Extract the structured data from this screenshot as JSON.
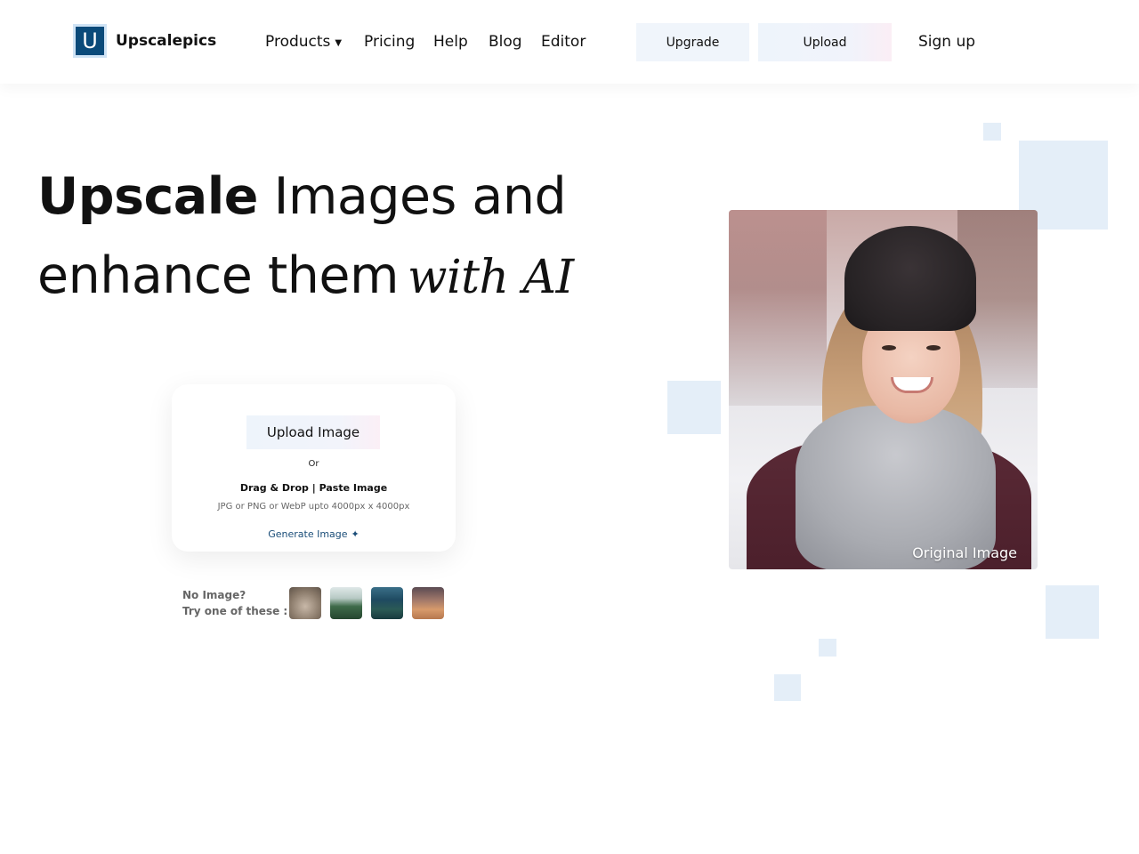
{
  "header": {
    "logo_letter": "U",
    "brand": "Upscalepics",
    "nav": [
      {
        "label": "Products",
        "has_caret": true
      },
      {
        "label": "Pricing"
      },
      {
        "label": "Help"
      },
      {
        "label": "Blog"
      },
      {
        "label": "Editor"
      }
    ],
    "caret_glyph": "▼",
    "upgrade_label": "Upgrade",
    "upload_label": "Upload",
    "signup_label": "Sign up"
  },
  "hero": {
    "line1_highlight": "Upscale",
    "line1_rest": " Images and",
    "line2_main": "enhance them",
    "line2_accent": "with AI"
  },
  "upload_card": {
    "button_label": "Upload Image",
    "or_text": "Or",
    "drag_drop_text": "Drag & Drop | Paste Image",
    "formats_text": "JPG or PNG or WebP upto 4000px x 4000px",
    "generate_label": "Generate Image",
    "sparkle_glyph": "✦"
  },
  "samples": {
    "line1": "No Image?",
    "line2": "Try one of these :",
    "thumbs": [
      "cat-thumbnail",
      "lake-thumbnail",
      "street-thumbnail",
      "laptop-thumbnail"
    ]
  },
  "hero_image": {
    "label": "Original Image"
  },
  "colors": {
    "accent": "#0a4a7a",
    "deco_square": "#e4eef8",
    "button_bg": "#f0f5fb"
  }
}
